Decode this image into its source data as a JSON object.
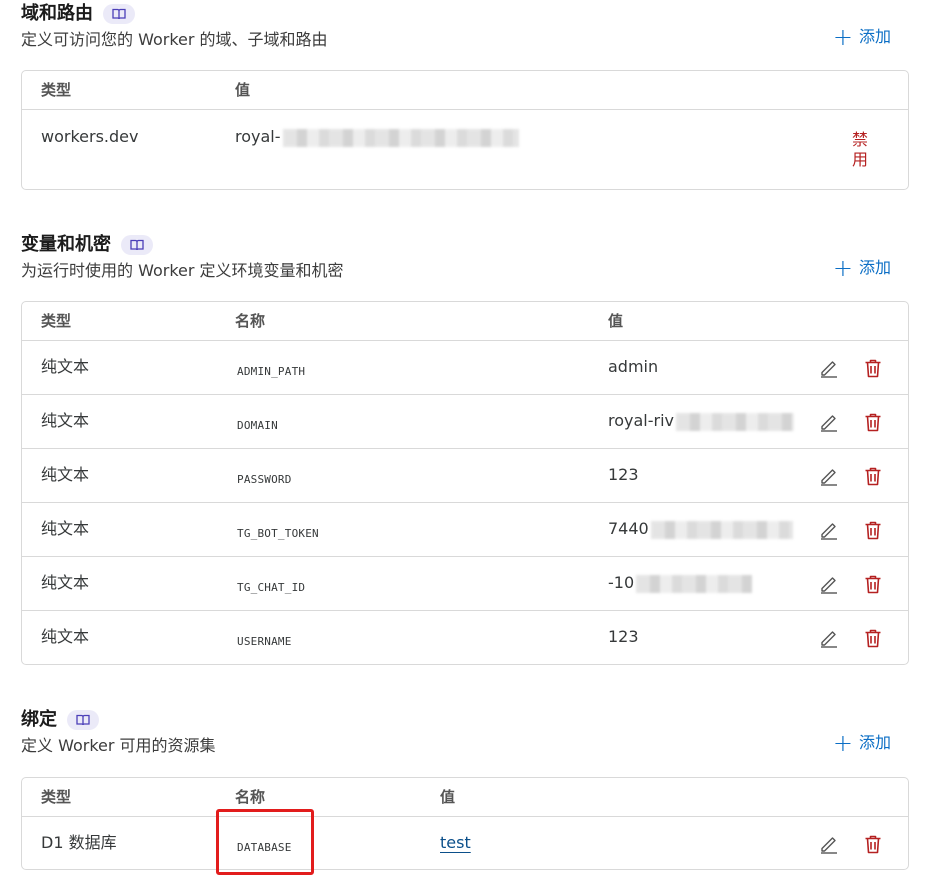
{
  "domains": {
    "title": "域和路由",
    "description": "定义可访问您的 Worker 的域、子域和路由",
    "add_label": "添加",
    "columns": [
      "类型",
      "值"
    ],
    "rows": [
      {
        "type": "workers.dev",
        "value_prefix": "royal-",
        "action": "禁用"
      }
    ]
  },
  "variables": {
    "title": "变量和机密",
    "description": "为运行时使用的 Worker 定义环境变量和机密",
    "add_label": "添加",
    "columns": [
      "类型",
      "名称",
      "值"
    ],
    "rows": [
      {
        "type": "纯文本",
        "name": "ADMIN_PATH",
        "value": "admin"
      },
      {
        "type": "纯文本",
        "name": "DOMAIN",
        "value": "royal-riv"
      },
      {
        "type": "纯文本",
        "name": "PASSWORD",
        "value": "123"
      },
      {
        "type": "纯文本",
        "name": "TG_BOT_TOKEN",
        "value": "7440"
      },
      {
        "type": "纯文本",
        "name": "TG_CHAT_ID",
        "value": "-10"
      },
      {
        "type": "纯文本",
        "name": "USERNAME",
        "value": "123"
      }
    ]
  },
  "bindings": {
    "title": "绑定",
    "description": "定义 Worker 可用的资源集",
    "add_label": "添加",
    "columns": [
      "类型",
      "名称",
      "值"
    ],
    "rows": [
      {
        "type": "D1 数据库",
        "name": "DATABASE",
        "value": "test"
      }
    ]
  },
  "icons": {
    "doc": "book-icon",
    "edit": "pencil-icon",
    "delete": "trash-icon",
    "add": "plus-icon"
  },
  "colors": {
    "accent": "#0b6ec5",
    "danger": "#b52121",
    "highlight": "#e21c1c",
    "badge_bg": "#ebeaf8"
  }
}
